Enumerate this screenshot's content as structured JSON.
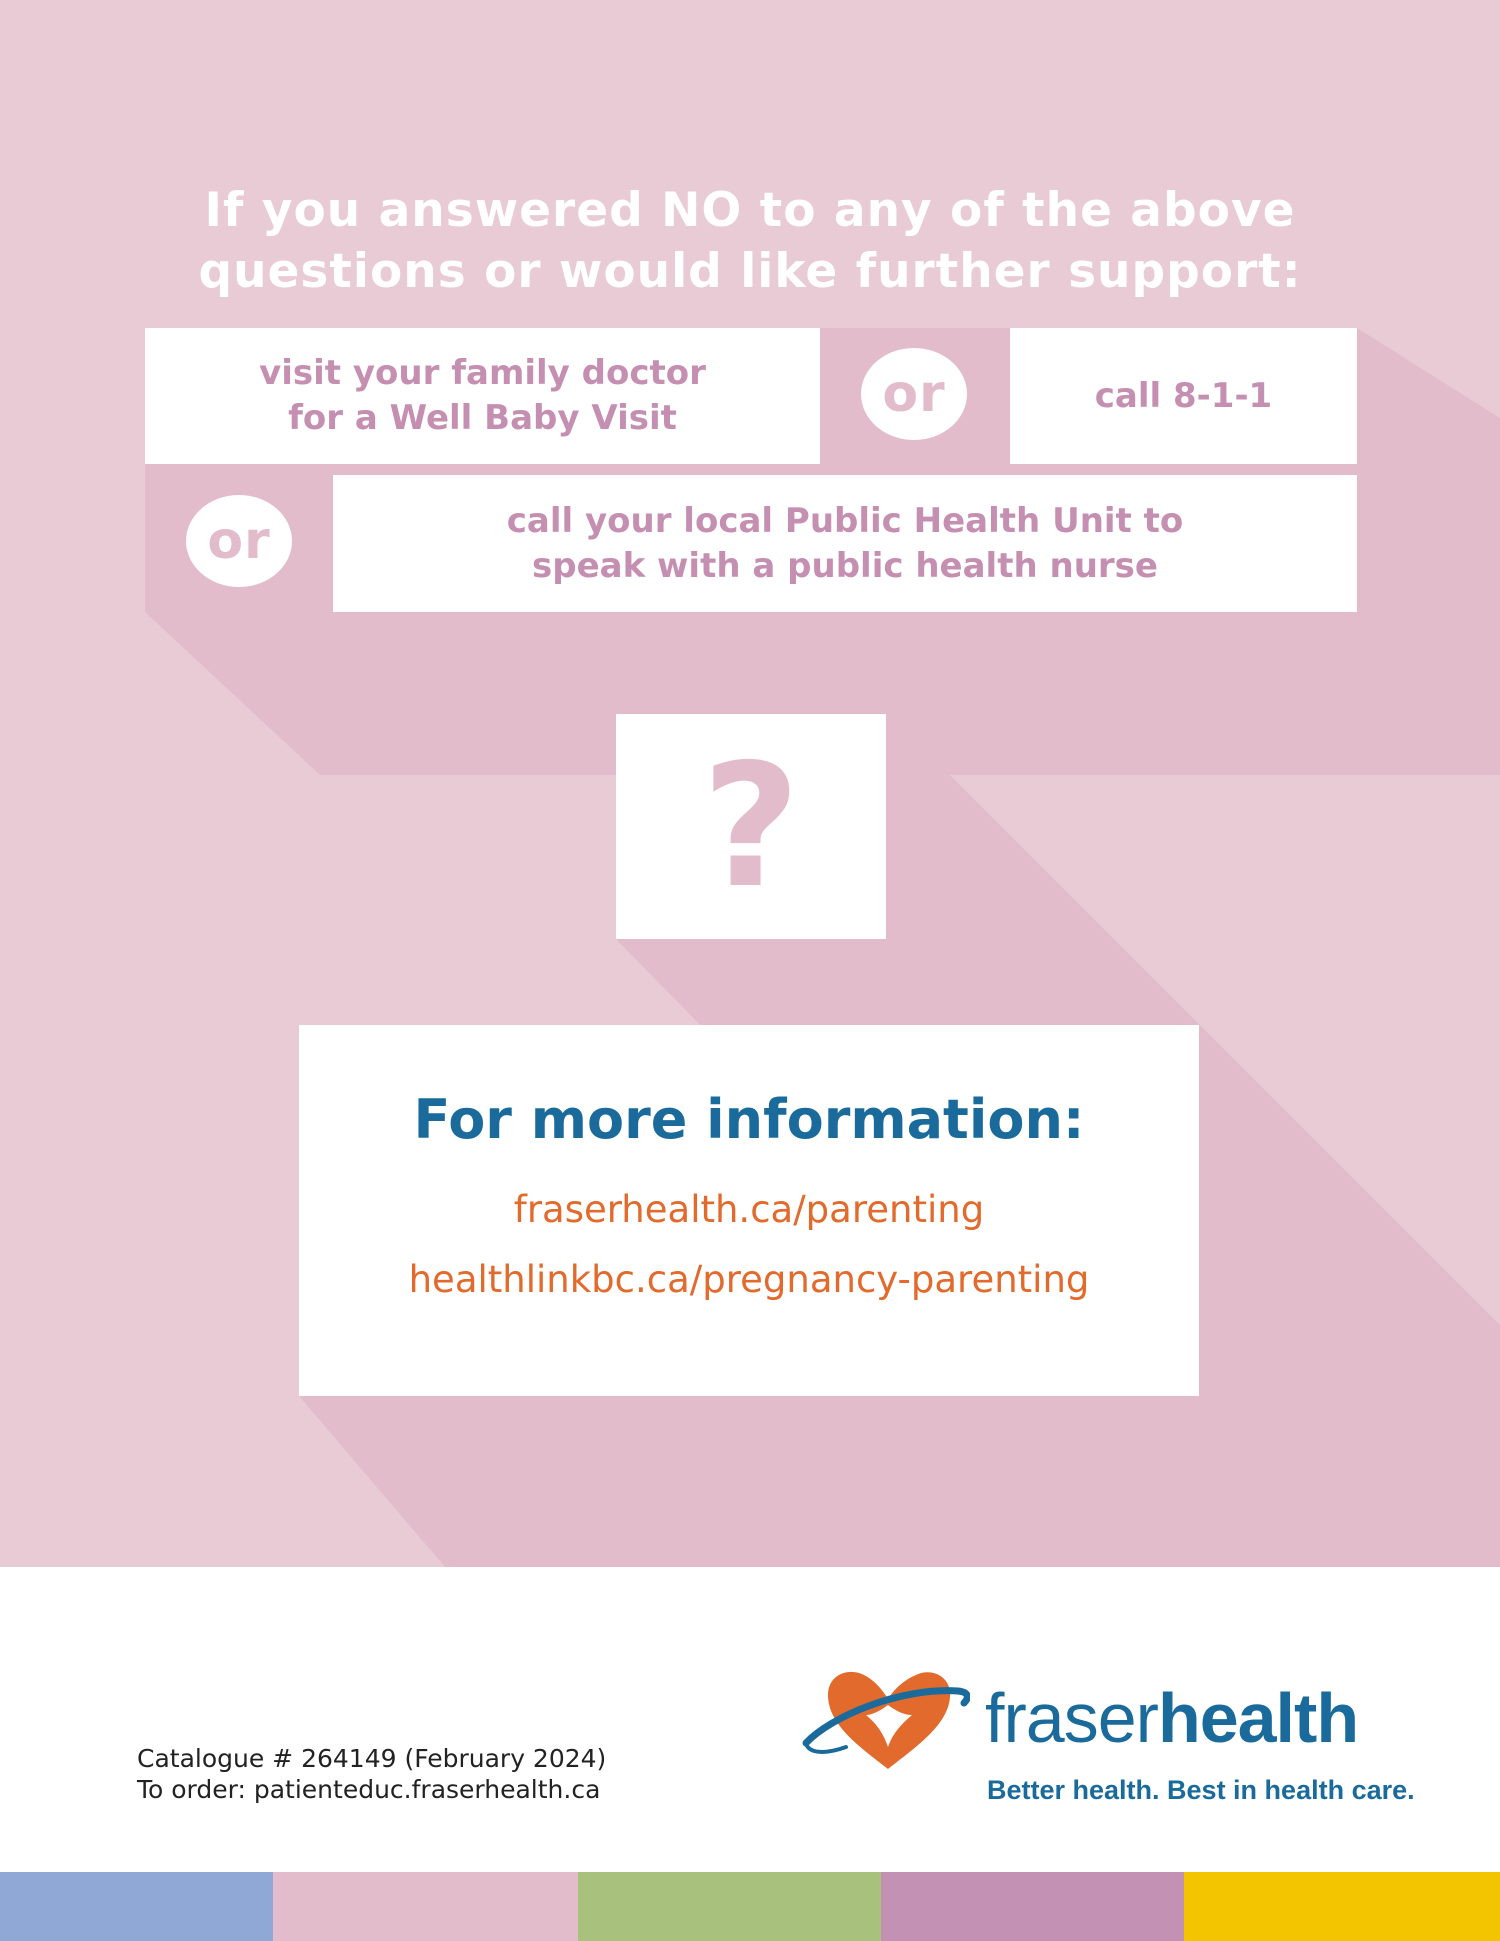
{
  "headline": {
    "line1": "If you answered NO to any of the above",
    "line2": "questions or would like further support:"
  },
  "options": {
    "doctor_line1": "visit your family doctor",
    "doctor_line2": "for a Well Baby Visit",
    "or_label": "or",
    "call": "call 8-1-1",
    "phu_line1": "call your local Public Health Unit to",
    "phu_line2": "speak with a public health nurse"
  },
  "question_mark": "?",
  "info": {
    "title": "For more information:",
    "link1": "fraserhealth.ca/parenting",
    "link2": "healthlinkbc.ca/pregnancy-parenting"
  },
  "footer": {
    "catalogue": "Catalogue # 264149 (February 2024)",
    "order": "To order: patienteduc.fraserhealth.ca"
  },
  "logo": {
    "word_light": "fraser",
    "word_bold": "health",
    "tagline": "Better health. Best in health care."
  },
  "colors": {
    "background_pink": "#e8cbd4",
    "shadow_pink": "#e3bccb",
    "text_mauve": "#c58fb1",
    "blue": "#1a6b9c",
    "orange": "#e26a2c",
    "stripe_colors": [
      "#8fa8d6",
      "#e3bccb",
      "#a8c27e",
      "#c291b3",
      "#f2c500"
    ]
  }
}
